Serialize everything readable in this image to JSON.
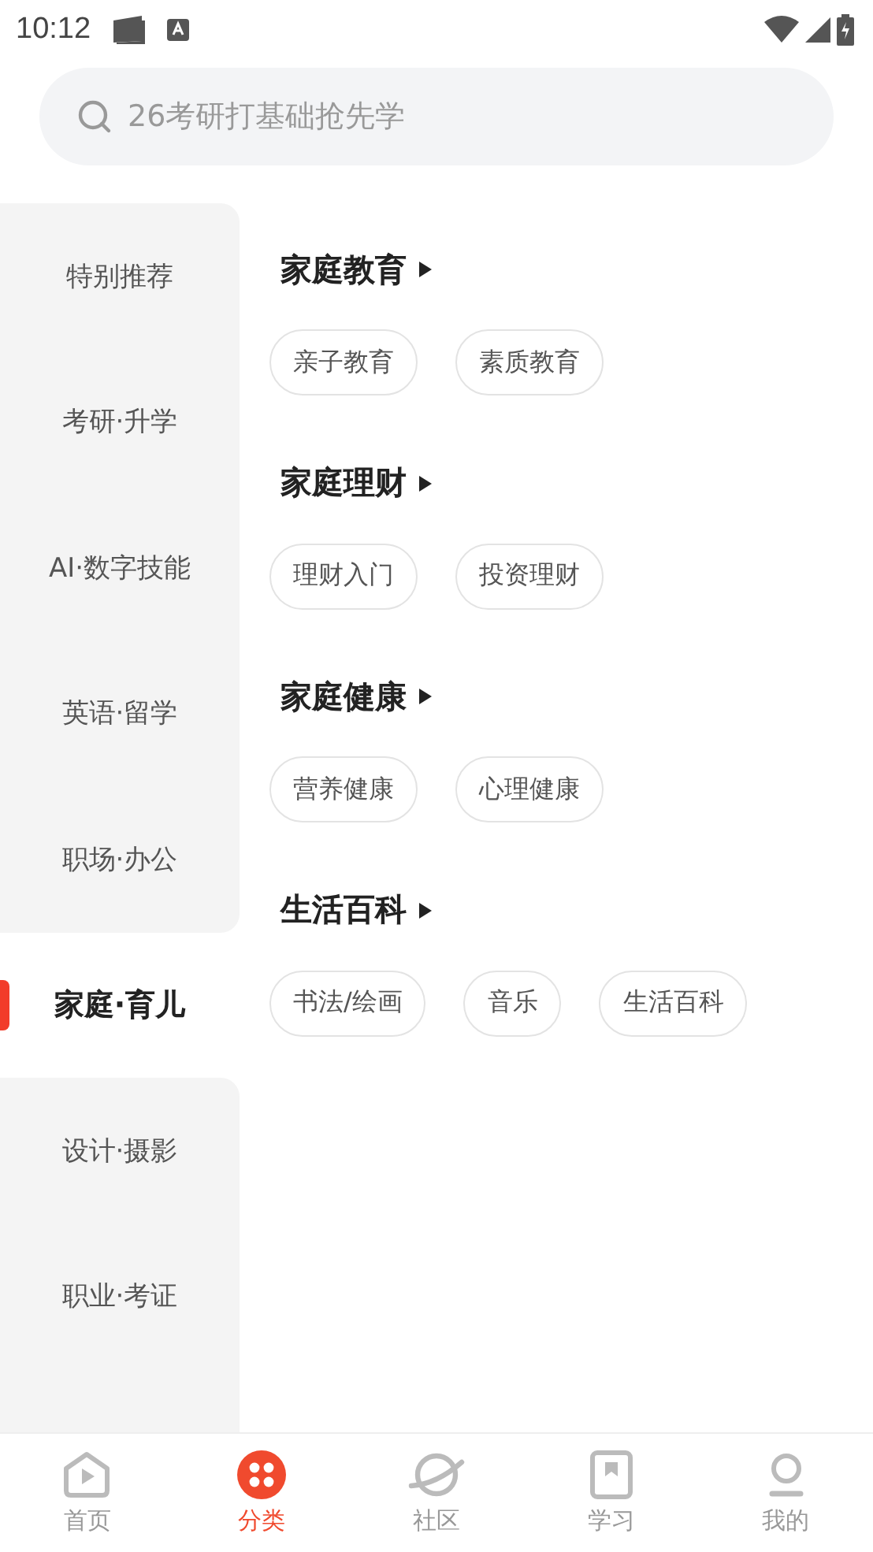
{
  "status_bar": {
    "time": "10:12"
  },
  "search": {
    "placeholder": "26考研打基础抢先学"
  },
  "sidebar": {
    "items": [
      {
        "label": "特别推荐",
        "selected": false
      },
      {
        "label": "考研·升学",
        "selected": false
      },
      {
        "label": "AI·数字技能",
        "selected": false
      },
      {
        "label": "英语·留学",
        "selected": false
      },
      {
        "label": "职场·办公",
        "selected": false
      },
      {
        "label": "家庭·育儿",
        "selected": true
      },
      {
        "label": "设计·摄影",
        "selected": false
      },
      {
        "label": "职业·考证",
        "selected": false
      }
    ]
  },
  "sections": [
    {
      "title": "家庭教育",
      "tags": [
        "亲子教育",
        "素质教育"
      ]
    },
    {
      "title": "家庭理财",
      "tags": [
        "理财入门",
        "投资理财"
      ]
    },
    {
      "title": "家庭健康",
      "tags": [
        "营养健康",
        "心理健康"
      ]
    },
    {
      "title": "生活百科",
      "tags": [
        "书法/绘画",
        "音乐",
        "生活百科"
      ]
    }
  ],
  "tab_bar": [
    {
      "kind": "home",
      "label": "首页",
      "selected": false
    },
    {
      "kind": "category",
      "label": "分类",
      "selected": true
    },
    {
      "kind": "community",
      "label": "社区",
      "selected": false
    },
    {
      "kind": "study",
      "label": "学习",
      "selected": false
    },
    {
      "kind": "mine",
      "label": "我的",
      "selected": false
    }
  ]
}
